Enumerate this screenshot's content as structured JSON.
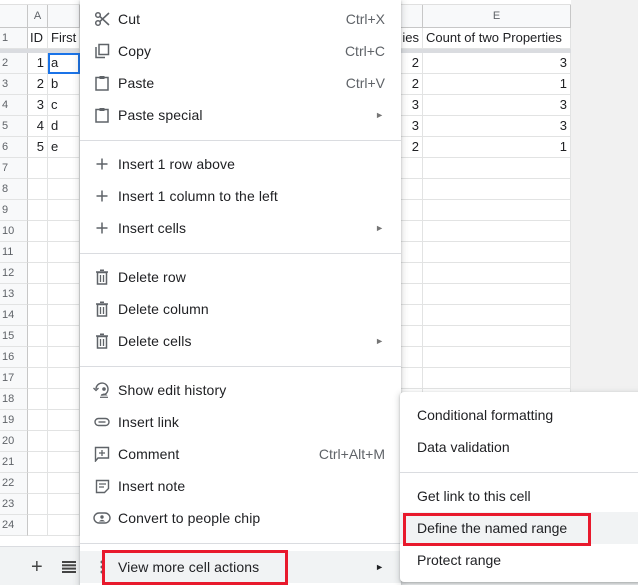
{
  "sheet": {
    "column_headers": [
      "A",
      "",
      "",
      "",
      "E"
    ],
    "row_numbers": [
      "1",
      "2",
      "3",
      "4",
      "5",
      "6",
      "7",
      "8",
      "9",
      "10",
      "11",
      "12",
      "13",
      "14",
      "15",
      "16",
      "17",
      "18",
      "19",
      "20",
      "21",
      "22",
      "23",
      "24"
    ],
    "header_row": {
      "A": "ID",
      "B": "First",
      "D": "ies",
      "E": "Count of two Properties"
    },
    "rows": [
      {
        "A": "1",
        "B": "a",
        "D": "2",
        "E": "3"
      },
      {
        "A": "2",
        "B": "b",
        "D": "2",
        "E": "1"
      },
      {
        "A": "3",
        "B": "c",
        "D": "3",
        "E": "3"
      },
      {
        "A": "4",
        "B": "d",
        "D": "3",
        "E": "3"
      },
      {
        "A": "5",
        "B": "e",
        "D": "2",
        "E": "1"
      }
    ],
    "selected_cell": "B2"
  },
  "bottom_bar": {
    "add_sheet_icon": "plus-icon",
    "all_sheets_icon": "list-icon"
  },
  "context_menu": {
    "groups": [
      [
        {
          "label": "Cut",
          "shortcut": "Ctrl+X",
          "icon": "scissors-icon"
        },
        {
          "label": "Copy",
          "shortcut": "Ctrl+C",
          "icon": "copy-icon"
        },
        {
          "label": "Paste",
          "shortcut": "Ctrl+V",
          "icon": "clipboard-icon"
        },
        {
          "label": "Paste special",
          "submenu": true,
          "icon": "clipboard-icon"
        }
      ],
      [
        {
          "label": "Insert 1 row above",
          "icon": "plus-icon"
        },
        {
          "label": "Insert 1 column to the left",
          "icon": "plus-icon"
        },
        {
          "label": "Insert cells",
          "submenu": true,
          "icon": "plus-icon"
        }
      ],
      [
        {
          "label": "Delete row",
          "icon": "trash-icon"
        },
        {
          "label": "Delete column",
          "icon": "trash-icon"
        },
        {
          "label": "Delete cells",
          "submenu": true,
          "icon": "trash-icon"
        }
      ],
      [
        {
          "label": "Show edit history",
          "icon": "history-icon"
        },
        {
          "label": "Insert link",
          "icon": "link-icon"
        },
        {
          "label": "Comment",
          "shortcut": "Ctrl+Alt+M",
          "icon": "comment-add-icon"
        },
        {
          "label": "Insert note",
          "icon": "note-icon"
        },
        {
          "label": "Convert to people chip",
          "icon": "person-chip-icon"
        }
      ],
      [
        {
          "label": "View more cell actions",
          "submenu": true,
          "icon": "more-vert-icon",
          "highlighted": true
        }
      ]
    ],
    "submenu_arrow": "►"
  },
  "submenu": {
    "items": [
      {
        "label": "Conditional formatting"
      },
      {
        "label": "Data validation"
      },
      {
        "label": "Get link to this cell"
      },
      {
        "label": "Define the named range",
        "highlighted": true
      },
      {
        "label": "Protect range"
      }
    ]
  },
  "annotations": {
    "highlight_color": "#e8192c",
    "boxed_items": [
      "View more cell actions",
      "Define the named range"
    ]
  }
}
